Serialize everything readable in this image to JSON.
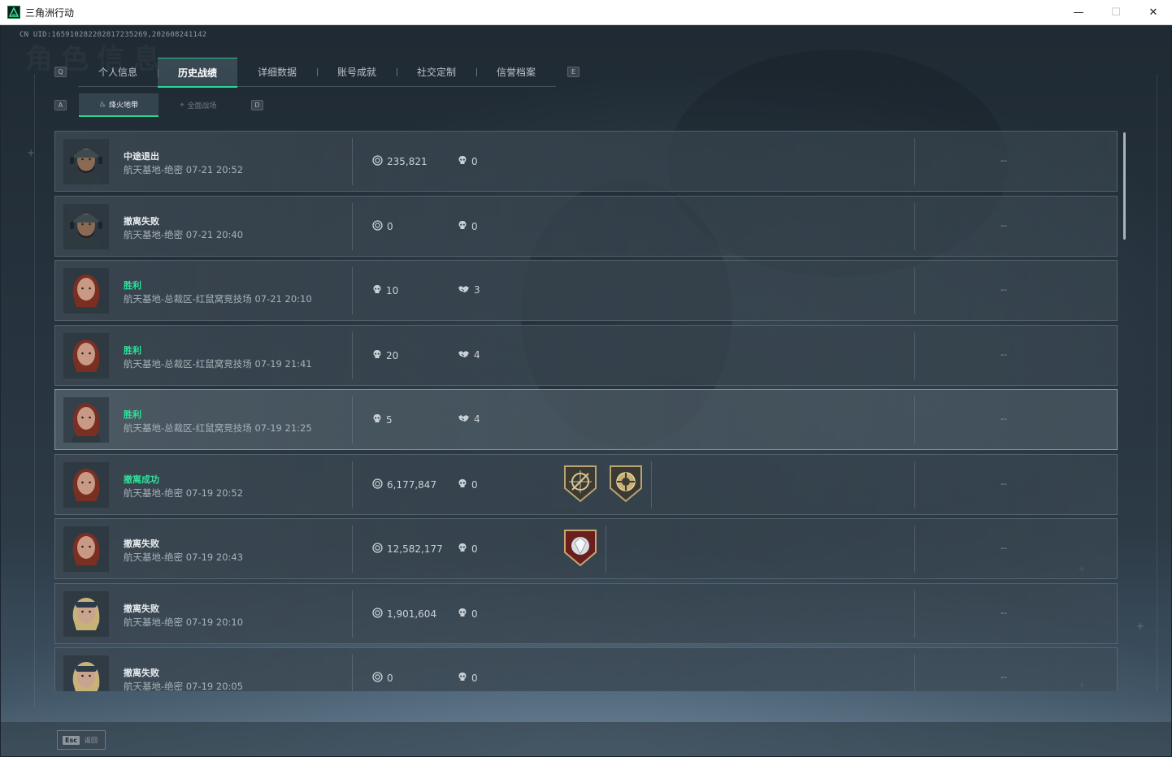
{
  "window": {
    "title": "三角洲行动",
    "minimize": "—",
    "maximize": "☐",
    "close": "✕"
  },
  "header": {
    "uid_text": "CN UID:16591028220281723526​9,202608241142",
    "left_key": "Q",
    "right_key": "E",
    "sub_left_key": "A",
    "sub_right_key": "D"
  },
  "tabs": [
    {
      "label": "个人信息",
      "active": false
    },
    {
      "label": "历史战绩",
      "active": true
    },
    {
      "label": "详细数据",
      "active": false
    },
    {
      "label": "账号成就",
      "active": false
    },
    {
      "label": "社交定制",
      "active": false
    },
    {
      "label": "信誉档案",
      "active": false
    }
  ],
  "subtabs": [
    {
      "label": "烽火地带",
      "icon": "flame-icon",
      "active": true
    },
    {
      "label": "全面战场",
      "icon": "crosshair-icon",
      "active": false
    }
  ],
  "matches": [
    {
      "result": "中途退出",
      "win": false,
      "detail": "航天基地-绝密 07-21 20:52",
      "stat1_icon": "coin-icon",
      "stat1": "235,821",
      "stat2_icon": "skull-icon",
      "stat2": "0",
      "badges": [],
      "extra": "--",
      "avatar": "male-cap",
      "highlight": false
    },
    {
      "result": "撤离失败",
      "win": false,
      "detail": "航天基地-绝密 07-21 20:40",
      "stat1_icon": "coin-icon",
      "stat1": "0",
      "stat2_icon": "skull-icon",
      "stat2": "0",
      "badges": [],
      "extra": "--",
      "avatar": "male-cap",
      "highlight": false
    },
    {
      "result": "胜利",
      "win": true,
      "detail": "航天基地-总裁区-红鼠窝竞技场 07-21 20:10",
      "stat1_icon": "skull-icon",
      "stat1": "10",
      "stat2_icon": "handshake-icon",
      "stat2": "3",
      "badges": [],
      "extra": "--",
      "avatar": "female-red",
      "highlight": false
    },
    {
      "result": "胜利",
      "win": true,
      "detail": "航天基地-总裁区-红鼠窝竞技场 07-19 21:41",
      "stat1_icon": "skull-icon",
      "stat1": "20",
      "stat2_icon": "handshake-icon",
      "stat2": "4",
      "badges": [],
      "extra": "--",
      "avatar": "female-red",
      "highlight": false
    },
    {
      "result": "胜利",
      "win": true,
      "detail": "航天基地-总裁区-红鼠窝竞技场 07-19 21:25",
      "stat1_icon": "skull-icon",
      "stat1": "5",
      "stat2_icon": "handshake-icon",
      "stat2": "4",
      "badges": [],
      "extra": "--",
      "avatar": "female-red",
      "highlight": true
    },
    {
      "result": "撤离成功",
      "win": true,
      "detail": "航天基地-绝密 07-19 20:52",
      "stat1_icon": "coin-icon",
      "stat1": "6,177,847",
      "stat2_icon": "skull-icon",
      "stat2": "0",
      "badges": [
        "sniper-badge-icon",
        "vault-badge-icon"
      ],
      "extra": "--",
      "avatar": "female-red",
      "highlight": false
    },
    {
      "result": "撤离失败",
      "win": false,
      "detail": "航天基地-绝密 07-19 20:43",
      "stat1_icon": "coin-icon",
      "stat1": "12,582,177",
      "stat2_icon": "skull-icon",
      "stat2": "0",
      "badges": [
        "diamond-badge-icon"
      ],
      "extra": "--",
      "avatar": "female-red",
      "highlight": false
    },
    {
      "result": "撤离失败",
      "win": false,
      "detail": "航天基地-绝密 07-19 20:10",
      "stat1_icon": "coin-icon",
      "stat1": "1,901,604",
      "stat2_icon": "skull-icon",
      "stat2": "0",
      "badges": [],
      "extra": "--",
      "avatar": "female-blonde",
      "highlight": false
    },
    {
      "result": "撤离失败",
      "win": false,
      "detail": "航天基地-绝密 07-19 20:05",
      "stat1_icon": "coin-icon",
      "stat1": "0",
      "stat2_icon": "skull-icon",
      "stat2": "0",
      "badges": [],
      "extra": "--",
      "avatar": "female-blonde",
      "highlight": false
    }
  ],
  "footer": {
    "esc_key": "Esc",
    "esc_label": "返回"
  },
  "colors": {
    "accent": "#2ed693",
    "win_text": "#2fe39a",
    "panel": "#3c4852"
  }
}
